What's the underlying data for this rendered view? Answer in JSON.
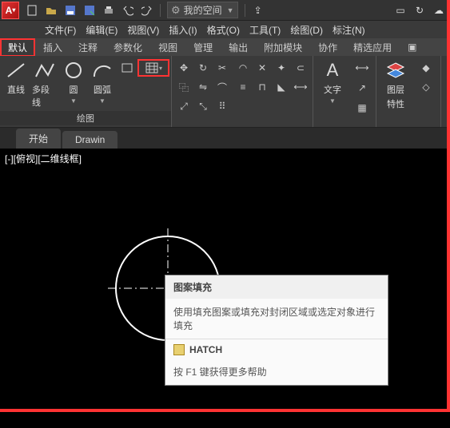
{
  "app_letter": "A",
  "workspace": "我的空间",
  "menus": [
    "文件(F)",
    "编辑(E)",
    "视图(V)",
    "插入(I)",
    "格式(O)",
    "工具(T)",
    "绘图(D)",
    "标注(N)"
  ],
  "tabs": [
    "默认",
    "插入",
    "注释",
    "参数化",
    "视图",
    "管理",
    "输出",
    "附加模块",
    "协作",
    "精选应用"
  ],
  "draw_panel": "绘图",
  "btn_line": "直线",
  "btn_pline": "多段线",
  "btn_circle": "圆",
  "btn_arc": "圆弧",
  "btn_text": "文字",
  "btn_layer": "图层",
  "btn_layer2": "特性",
  "filetabs": [
    "开始",
    "Drawin"
  ],
  "viewlabel": "[-][俯视][二维线框]",
  "tooltip": {
    "title": "图案填充",
    "desc": "使用填充图案或填充对封闭区域或选定对象进行填充",
    "cmd": "HATCH",
    "help": "按 F1 键获得更多帮助"
  }
}
